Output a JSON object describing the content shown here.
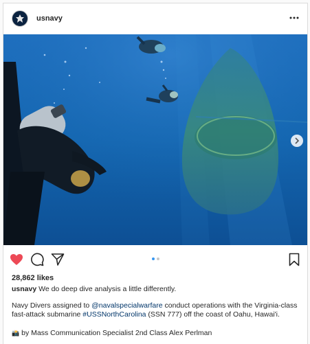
{
  "post": {
    "username": "usnavy",
    "likes": "28,862 likes",
    "caption_user": "usnavy",
    "caption_text": "We do deep dive analysis a little differently.",
    "body_prefix": "Navy Divers assigned to ",
    "mention": "@navalspecialwarfare",
    "body_middle": " conduct operations with the Virginia-class fast-attack submarine ",
    "hashtag": "#USSNorthCarolina",
    "body_suffix": " (SSN 777) off the coast of Oahu, Hawai'i.",
    "camera_emoji": "📸",
    "credit": " by Mass Communication Specialist 2nd Class Alex Perlman",
    "cutoff_line": "– – – – – – – – – – – – – – – – – – – – – – – –"
  },
  "carousel": {
    "current": 1,
    "total": 2
  },
  "icons": {
    "avatar": "navy-emblem-icon",
    "more": "more-options-icon",
    "like": "heart-icon",
    "comment": "comment-icon",
    "share": "share-icon",
    "save": "bookmark-icon",
    "next": "chevron-right-icon"
  },
  "colors": {
    "heart": "#ed4956",
    "link": "#003569",
    "dot_active": "#3897f0",
    "ocean": "#1565a8"
  }
}
